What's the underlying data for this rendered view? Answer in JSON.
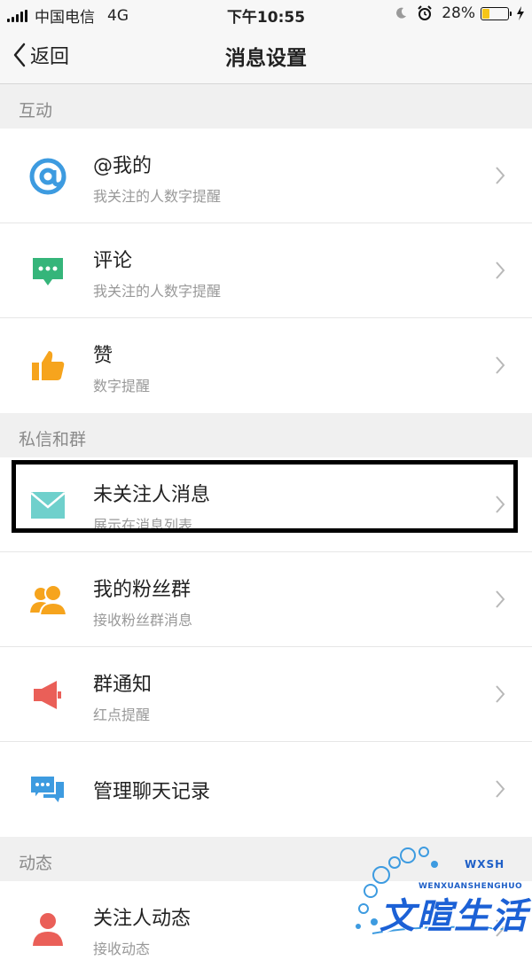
{
  "status_bar": {
    "carrier": "中国电信",
    "network": "4G",
    "time": "下午10:55",
    "battery_percent": "28%",
    "battery_level": 0.28
  },
  "nav": {
    "back_label": "返回",
    "title": "消息设置"
  },
  "sections": [
    {
      "header": "互动",
      "items": [
        {
          "title": "@我的",
          "subtitle": "我关注的人数字提醒",
          "icon": "at-icon",
          "color": "#3d9be0"
        },
        {
          "title": "评论",
          "subtitle": "我关注的人数字提醒",
          "icon": "comment-icon",
          "color": "#35b57a"
        },
        {
          "title": "赞",
          "subtitle": "数字提醒",
          "icon": "thumbs-up-icon",
          "color": "#f6a41d"
        }
      ]
    },
    {
      "header": "私信和群",
      "items": [
        {
          "title": "未关注人消息",
          "subtitle": "展示在消息列表",
          "icon": "envelope-icon",
          "color": "#6fd0cc"
        },
        {
          "title": "我的粉丝群",
          "subtitle": "接收粉丝群消息",
          "icon": "group-icon",
          "color": "#f6a41d"
        },
        {
          "title": "群通知",
          "subtitle": "红点提醒",
          "icon": "megaphone-icon",
          "color": "#ea5f58"
        },
        {
          "title": "管理聊天记录",
          "subtitle": "",
          "icon": "chat-bubbles-icon",
          "color": "#3d9be0"
        }
      ]
    },
    {
      "header": "动态",
      "items": [
        {
          "title": "关注人动态",
          "subtitle": "接收动态",
          "icon": "person-icon",
          "color": "#ea5f58"
        }
      ]
    }
  ],
  "watermark": {
    "tag": "WXSH",
    "pinyin": "WENXUANSHENGHUO",
    "text": "文暄生活"
  }
}
